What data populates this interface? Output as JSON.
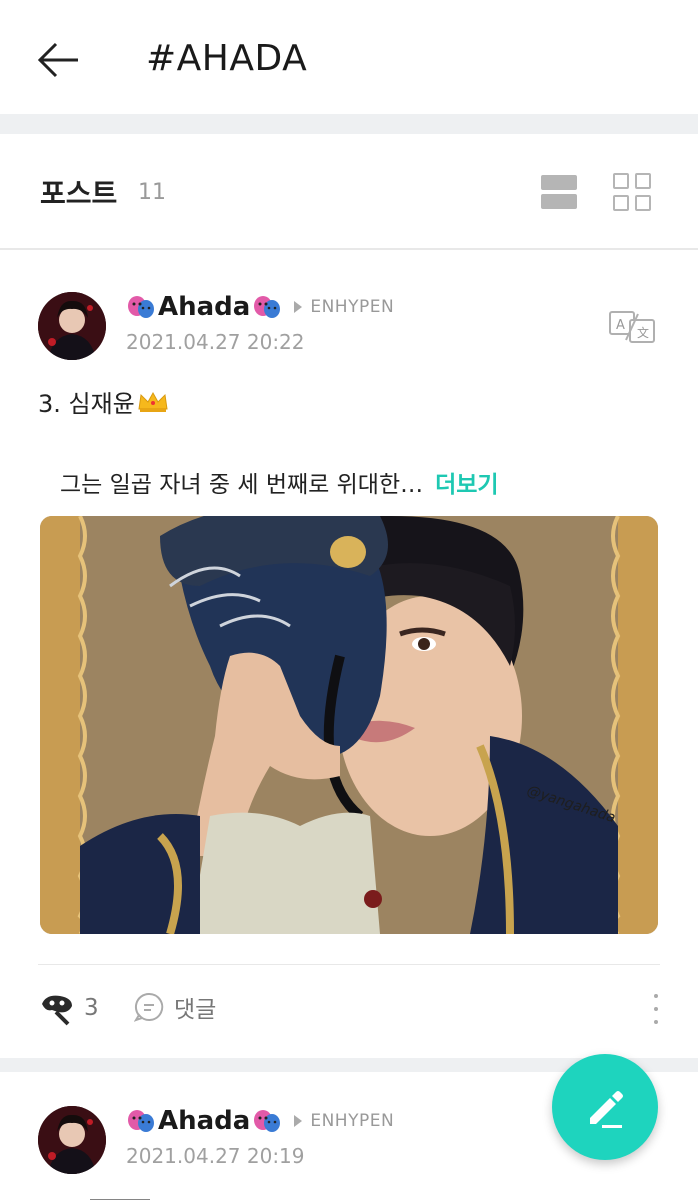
{
  "header": {
    "title": "#AHADA",
    "back_icon": "arrow-left-icon"
  },
  "tabbar": {
    "label": "포스트",
    "count": "11",
    "list_view_icon": "list-view-icon",
    "grid_view_icon": "grid-view-icon"
  },
  "posts": [
    {
      "author": "Ahada",
      "board": "ENHYPEN",
      "time": "2021.04.27 20:22",
      "title": "3. 심재윤",
      "excerpt": "그는 일곱 자녀 중 세 번째로 위대한…",
      "more_label": "더보기",
      "image_watermark": "@yangahada",
      "likes": "3",
      "comment_label": "댓글"
    },
    {
      "author": "Ahada",
      "board": "ENHYPEN",
      "time": "2021.04.27 20:19"
    }
  ],
  "colors": {
    "accent": "#1ec8b2",
    "fab": "#1ed4be",
    "band": "#eef0f2"
  },
  "fab": {
    "icon": "pencil-icon"
  }
}
